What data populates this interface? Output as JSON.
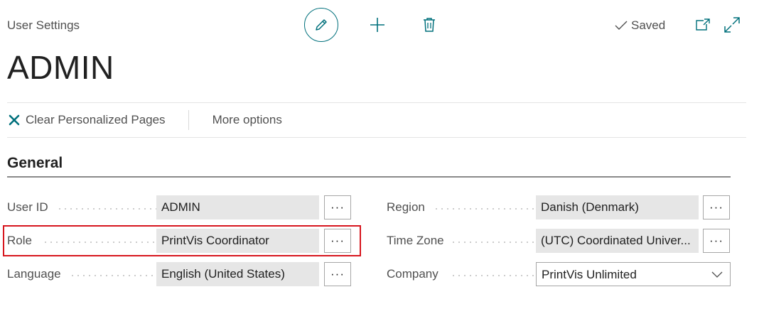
{
  "header": {
    "caption": "User Settings",
    "title": "ADMIN",
    "saved_label": "Saved"
  },
  "actions": {
    "clear_label": "Clear Personalized Pages",
    "more_label": "More options"
  },
  "section": {
    "title": "General"
  },
  "fields": {
    "user_id": {
      "label": "User ID",
      "value": "ADMIN",
      "lookup": "···"
    },
    "role": {
      "label": "Role",
      "value": "PrintVis Coordinator",
      "lookup": "···"
    },
    "language": {
      "label": "Language",
      "value": "English (United States)",
      "lookup": "···"
    },
    "region": {
      "label": "Region",
      "value": "Danish (Denmark)",
      "lookup": "···"
    },
    "time_zone": {
      "label": "Time Zone",
      "value": "(UTC) Coordinated Univer...",
      "lookup": "···"
    },
    "company": {
      "label": "Company",
      "value": "PrintVis Unlimited"
    }
  },
  "colors": {
    "accent": "#00707c",
    "highlight": "#d7161e",
    "field_bg": "#e6e6e6"
  },
  "icons": {
    "edit": "pencil-icon",
    "new": "plus-icon",
    "delete": "trash-icon",
    "saved": "checkmark-icon",
    "popout": "popout-icon",
    "expand": "expand-icon",
    "clear": "x-icon",
    "dropdown": "chevron-down-icon"
  }
}
